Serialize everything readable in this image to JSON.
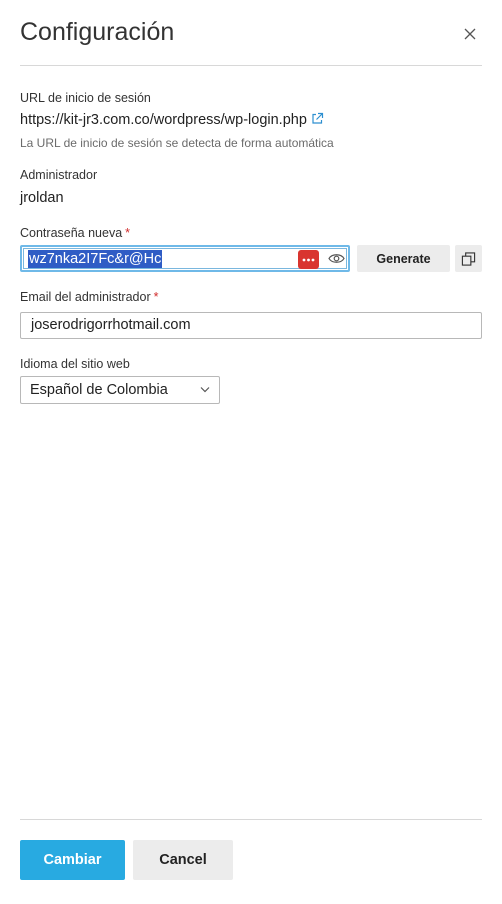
{
  "dialog": {
    "title": "Configuración",
    "close_icon": "close-icon"
  },
  "login_url": {
    "label": "URL de inicio de sesión",
    "value": "https://kit-jr3.com.co/wordpress/wp-login.php",
    "hint": "La URL de inicio de sesión se detecta de forma automática",
    "icon": "external-link-icon"
  },
  "admin": {
    "label": "Administrador",
    "value": "jroldan"
  },
  "password": {
    "label": "Contraseña nueva",
    "required_mark": "*",
    "value": "wz7nka2I7Fc&r@Hc",
    "generate_label": "Generate",
    "icons": [
      "password-manager-icon",
      "eye-icon",
      "copy-icon"
    ]
  },
  "email": {
    "label": "Email del administrador",
    "required_mark": "*",
    "value": "joserodrigorrhotmail.com"
  },
  "language": {
    "label": "Idioma del sitio web",
    "selected": "Español de Colombia"
  },
  "footer": {
    "submit_label": "Cambiar",
    "cancel_label": "Cancel"
  },
  "colors": {
    "primary": "#28aae1",
    "required": "#d02b2b",
    "selection": "#2f5cc5",
    "focus_border": "#6fb9e8",
    "password_manager": "#d9352f"
  }
}
